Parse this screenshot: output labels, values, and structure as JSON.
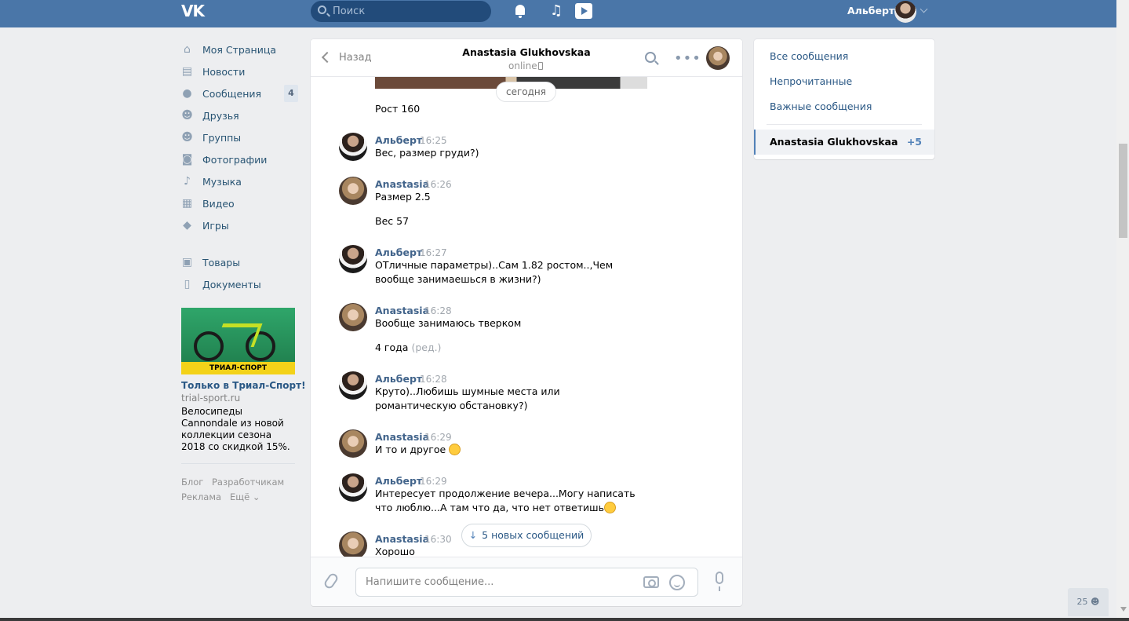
{
  "topbar": {
    "logo": "VK",
    "search_placeholder": "Поиск",
    "user_name": "Альберт"
  },
  "nav": {
    "items": [
      {
        "label": "Моя Страница",
        "icon": "home-icon"
      },
      {
        "label": "Новости",
        "icon": "news-icon"
      },
      {
        "label": "Сообщения",
        "icon": "messages-icon",
        "badge": "4"
      },
      {
        "label": "Друзья",
        "icon": "friends-icon"
      },
      {
        "label": "Группы",
        "icon": "groups-icon"
      },
      {
        "label": "Фотографии",
        "icon": "camera-icon"
      },
      {
        "label": "Музыка",
        "icon": "music-icon"
      },
      {
        "label": "Видео",
        "icon": "video-icon"
      },
      {
        "label": "Игры",
        "icon": "games-icon"
      },
      {
        "label": "Товары",
        "icon": "bag-icon"
      },
      {
        "label": "Документы",
        "icon": "document-icon"
      }
    ]
  },
  "ad": {
    "banner": "ТРИАЛ-СПОРТ",
    "title": "Только в Триал-Спорт!",
    "domain": "trial-sport.ru",
    "text": "Велосипеды Cannondale из новой коллекции сезона 2018 со скидкой 15%."
  },
  "footer": {
    "blog": "Блог",
    "developers": "Разработчикам",
    "ads": "Реклама",
    "more": "Ещё"
  },
  "chat": {
    "back_label": "Назад",
    "peer_name": "Anastasia Glukhovskaa",
    "peer_status": "online",
    "date_separator": "сегодня",
    "messages": [
      {
        "text": "Рост 160"
      },
      {
        "author": "Альберт",
        "time": "16:25",
        "text": "Вес, размер груди?)"
      },
      {
        "author": "Anastasia",
        "time": "16:26",
        "text": "Размер 2.5"
      },
      {
        "text": "Вес 57"
      },
      {
        "author": "Альберт",
        "time": "16:27",
        "text": "ОТличные параметры)..Сам 1.82 ростом..,Чем вообще занимаешься в жизни?)"
      },
      {
        "author": "Anastasia",
        "time": "16:28",
        "text": "Вообще занимаюсь тверком"
      },
      {
        "text": "4 года",
        "edited": "(ред.)"
      },
      {
        "author": "Альберт",
        "time": "16:28",
        "text": "Круто)..Любишь шумные места или романтическую обстановку?)"
      },
      {
        "author": "Anastasia",
        "time": "16:29",
        "text": "И то и другое"
      },
      {
        "author": "Альберт",
        "time": "16:29",
        "text": "Интересует продолжение вечера...Могу написать что люблю...А там что да, что нет ответишь"
      },
      {
        "author": "Anastasia",
        "time": "16:30",
        "text": "Хорошо"
      }
    ],
    "new_messages": "5 новых сообщений",
    "compose_placeholder": "Напишите сообщение..."
  },
  "right_panel": {
    "all": "Все сообщения",
    "unread": "Непрочитанные",
    "important": "Важные сообщения",
    "active_dialog": "Anastasia Glukhovskaa",
    "active_count": "+5"
  },
  "online_count": "25"
}
